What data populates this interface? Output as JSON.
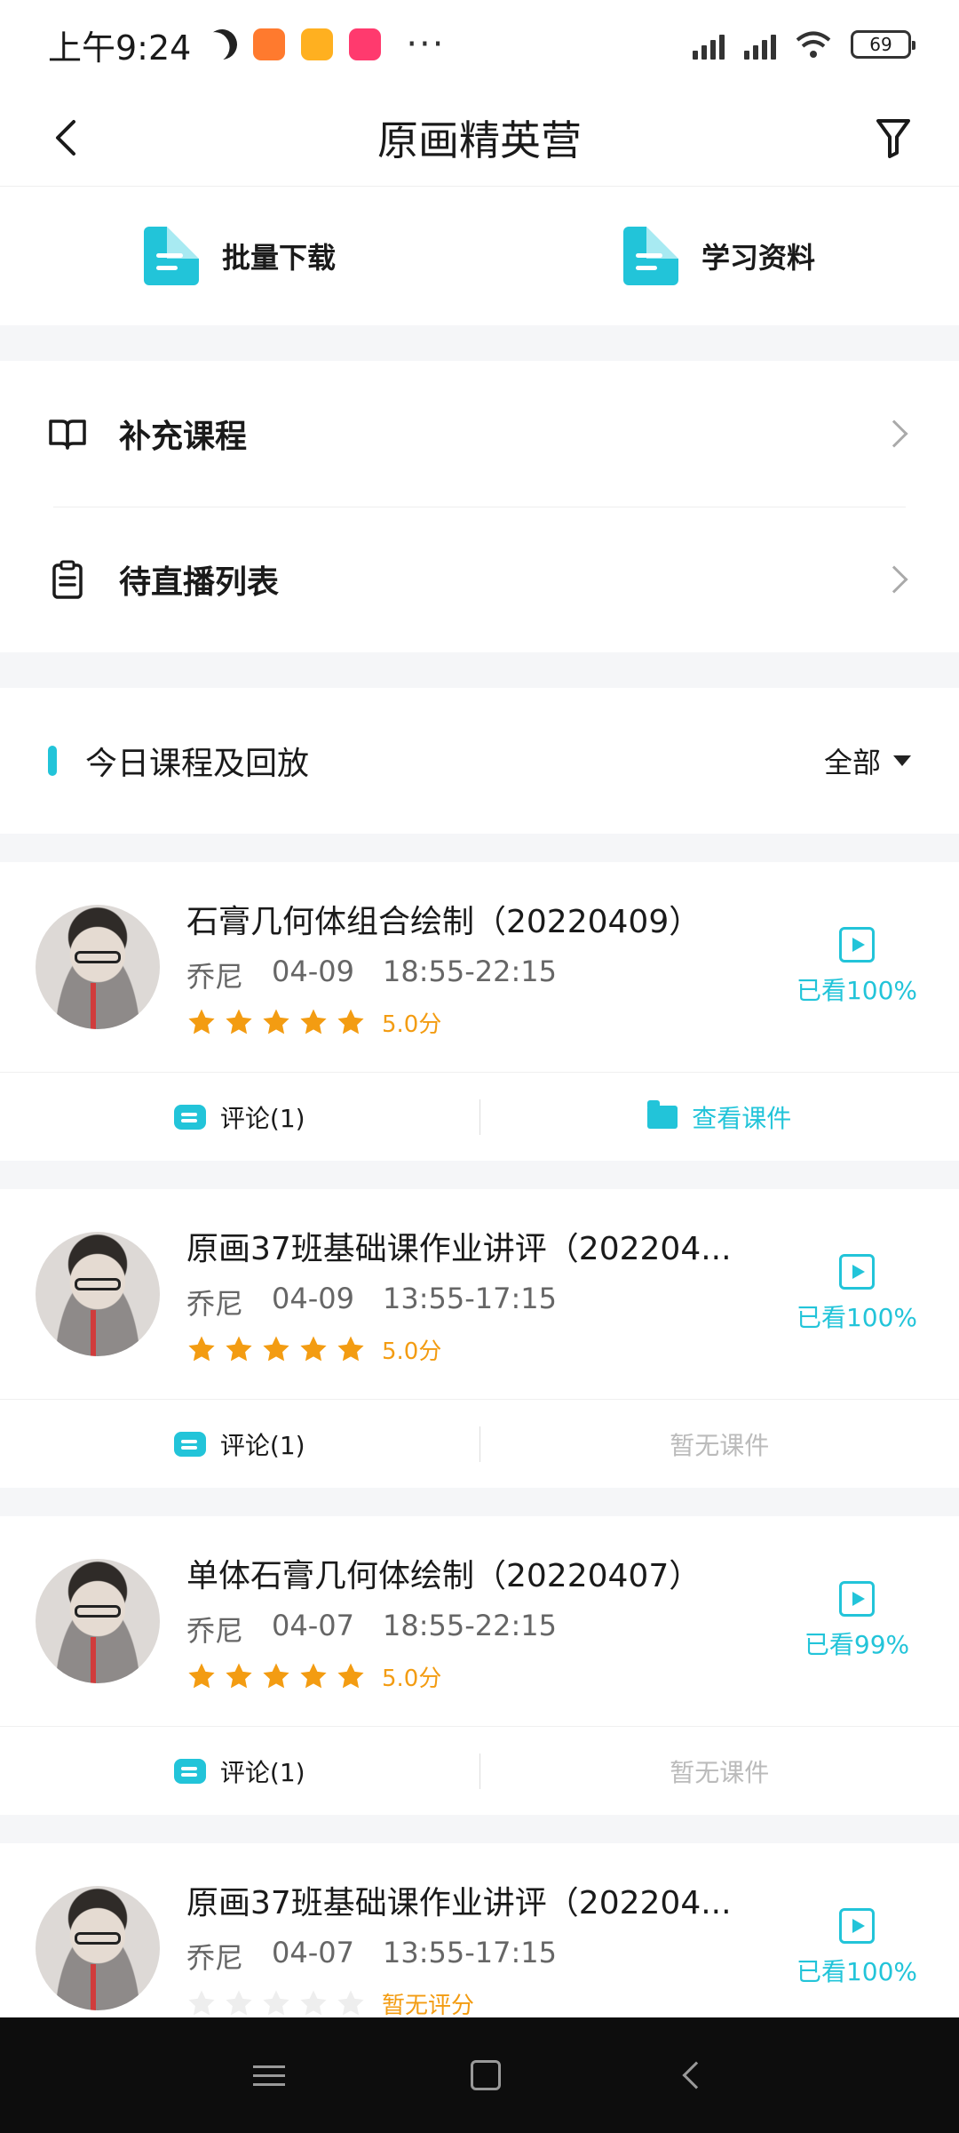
{
  "status_bar": {
    "time": "上午9:24",
    "battery": "69",
    "more": "···"
  },
  "header": {
    "title": "原画精英营"
  },
  "quick_actions": [
    {
      "label": "批量下载",
      "icon": "document-icon"
    },
    {
      "label": "学习资料",
      "icon": "document-icon"
    }
  ],
  "menu": {
    "items": [
      {
        "label": "补充课程",
        "icon": "book-icon"
      },
      {
        "label": "待直播列表",
        "icon": "clipboard-icon"
      }
    ]
  },
  "section": {
    "title": "今日课程及回放",
    "filter": "全部"
  },
  "courses": [
    {
      "title": "石膏几何体组合绘制（20220409）",
      "teacher": "乔尼",
      "date": "04-09",
      "time": "18:55-22:15",
      "stars": 5,
      "score": "5.0分",
      "watched": "已看100%",
      "comment": "评论(1)",
      "material": "查看课件",
      "material_available": true
    },
    {
      "title": "原画37班基础课作业讲评（202204...",
      "teacher": "乔尼",
      "date": "04-09",
      "time": "13:55-17:15",
      "stars": 5,
      "score": "5.0分",
      "watched": "已看100%",
      "comment": "评论(1)",
      "material": "暂无课件",
      "material_available": false
    },
    {
      "title": "单体石膏几何体绘制（20220407）",
      "teacher": "乔尼",
      "date": "04-07",
      "time": "18:55-22:15",
      "stars": 5,
      "score": "5.0分",
      "watched": "已看99%",
      "comment": "评论(1)",
      "material": "暂无课件",
      "material_available": false
    },
    {
      "title": "原画37班基础课作业讲评（202204...",
      "teacher": "乔尼",
      "date": "04-07",
      "time": "13:55-17:15",
      "stars": 0,
      "score": "暂无评分",
      "watched": "已看100%"
    }
  ],
  "colors": {
    "accent": "#22c4d9",
    "star": "#f39c12",
    "star_empty": "#eeeeee"
  }
}
